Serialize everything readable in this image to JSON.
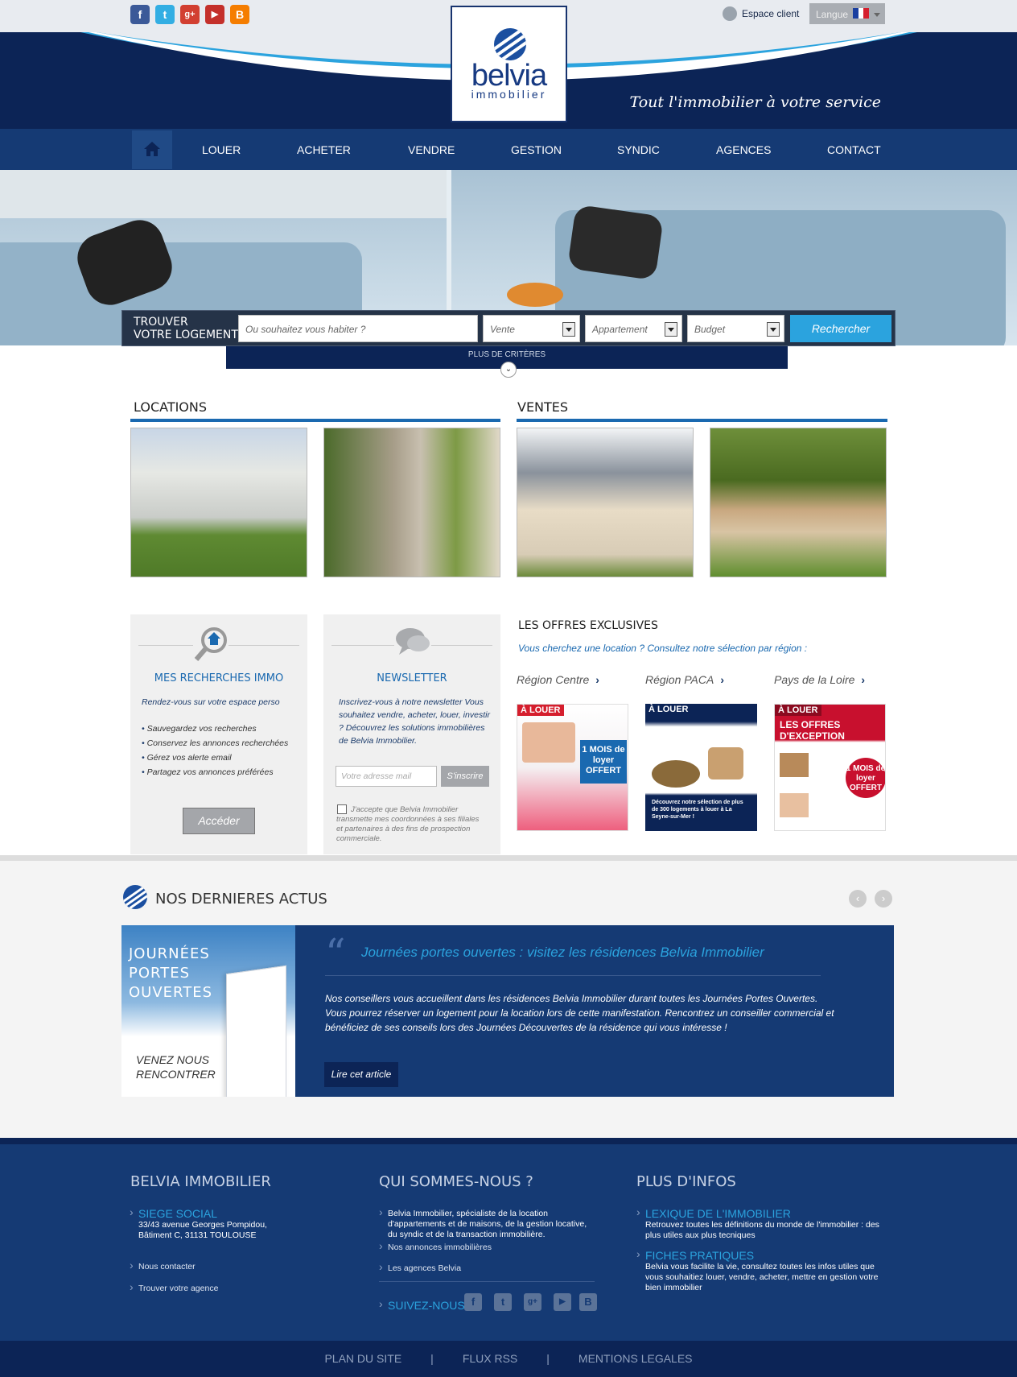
{
  "topbar": {
    "social": [
      {
        "icon": "facebook-icon",
        "glyph": "f",
        "color": "#3b5998"
      },
      {
        "icon": "twitter-icon",
        "glyph": "t",
        "color": "#33aee3"
      },
      {
        "icon": "googleplus-icon",
        "glyph": "g+",
        "color": "#d23f31"
      },
      {
        "icon": "youtube-icon",
        "glyph": "▶",
        "color": "#c4302b"
      },
      {
        "icon": "blogger-icon",
        "glyph": "B",
        "color": "#f57d00"
      }
    ],
    "espace_client": "Espace client",
    "langue": "Langue"
  },
  "header": {
    "logo_name": "belvia",
    "logo_sub": "immobilier",
    "tagline": "Tout l'immobilier à votre service"
  },
  "nav": {
    "items": [
      "LOUER",
      "ACHETER",
      "VENDRE",
      "GESTION",
      "SYNDIC",
      "AGENCES",
      "CONTACT"
    ]
  },
  "search": {
    "label_line1": "TROUVER",
    "label_line2": "VOTRE LOGEMENT",
    "where_placeholder": "Ou souhaitez vous habiter ?",
    "type_value": "Vente",
    "property_value": "Appartement",
    "budget_value": "Budget",
    "submit": "Rechercher",
    "more": "PLUS DE CRITÈRES"
  },
  "listings": {
    "locations_title": "LOCATIONS",
    "ventes_title": "VENTES"
  },
  "recherches": {
    "title": "MES RECHERCHES IMMO",
    "intro": "Rendez-vous sur votre espace perso",
    "bullets": [
      "Sauvegardez vos recherches",
      "Conservez les annonces recherchées",
      "Gérez vos alerte email",
      "Partagez vos annonces préférées"
    ],
    "button": "Accéder"
  },
  "newsletter": {
    "title": "NEWSLETTER",
    "text": "Inscrivez-vous à notre newsletter Vous souhaitez vendre, acheter, louer, investir ? Découvrez les solutions immobilières de Belvia Immobilier.",
    "placeholder": "Votre adresse mail",
    "button": "S'inscrire",
    "consent": "J'accepte que Belvia Immobilier transmette mes coordonnées à ses filiales et partenaires à des fins de prospection commerciale."
  },
  "offres": {
    "title": "LES OFFRES EXCLUSIVES",
    "subtitle": "Vous cherchez une location ? Consultez notre sélection par région :",
    "regions": [
      "Région Centre",
      "Région PACA",
      "Pays de la Loire"
    ],
    "flyer_tag": "À LOUER",
    "flyer1_text": "1 MOIS de loyer OFFERT",
    "flyer2_text": "Découvrez notre sélection de plus de 300 logements à louer à La Seyne-sur-Mer !",
    "flyer3_text": "LES OFFRES D'EXCEPTION"
  },
  "actus": {
    "title": "NOS DERNIERES ACTUS",
    "img_title": "JOURNÉES PORTES OUVERTES",
    "img_sub": "VENEZ NOUS RENCONTRER",
    "headline": "Journées portes ouvertes : visitez les résidences Belvia Immobilier",
    "body": "Nos conseillers vous accueillent dans les résidences Belvia Immobilier durant toutes les Journées Portes Ouvertes. Vous pourrez réserver un logement pour la location lors de cette manifestation. Rencontrez un conseiller commercial et bénéficiez de ses conseils lors des Journées Découvertes de la résidence qui vous intéresse !",
    "button": "Lire cet article"
  },
  "footer": {
    "col1_title": "BELVIA IMMOBILIER",
    "siege_label": "SIEGE SOCIAL",
    "address": "33/43 avenue Georges Pompidou, Bâtiment C, 31131 TOULOUSE",
    "contact": "Nous contacter",
    "agence": "Trouver votre agence",
    "col2_title": "QUI SOMMES-NOUS ?",
    "about": "Belvia Immobilier, spécialiste de la location d'appartements et de maisons, de la gestion locative, du syndic et de la transaction immobilière.",
    "annonces": "Nos annonces immobilières",
    "agences": "Les agences Belvia",
    "suivez": "SUIVEZ-NOUS",
    "col3_title": "PLUS D'INFOS",
    "lexique_title": "LEXIQUE DE L'IMMOBILIER",
    "lexique_text": "Retrouvez toutes les définitions du monde de l'immobilier : des plus utiles aux plus tecniques",
    "fiches_title": "FICHES PRATIQUES",
    "fiches_text": "Belvia vous facilite la vie, consultez toutes les infos utiles que vous souhaitiez louer, vendre, acheter, mettre en gestion votre bien immobilier"
  },
  "bottom": {
    "links": [
      "PLAN DU SITE",
      "FLUX RSS",
      "MENTIONS LEGALES"
    ],
    "sep": "|"
  }
}
